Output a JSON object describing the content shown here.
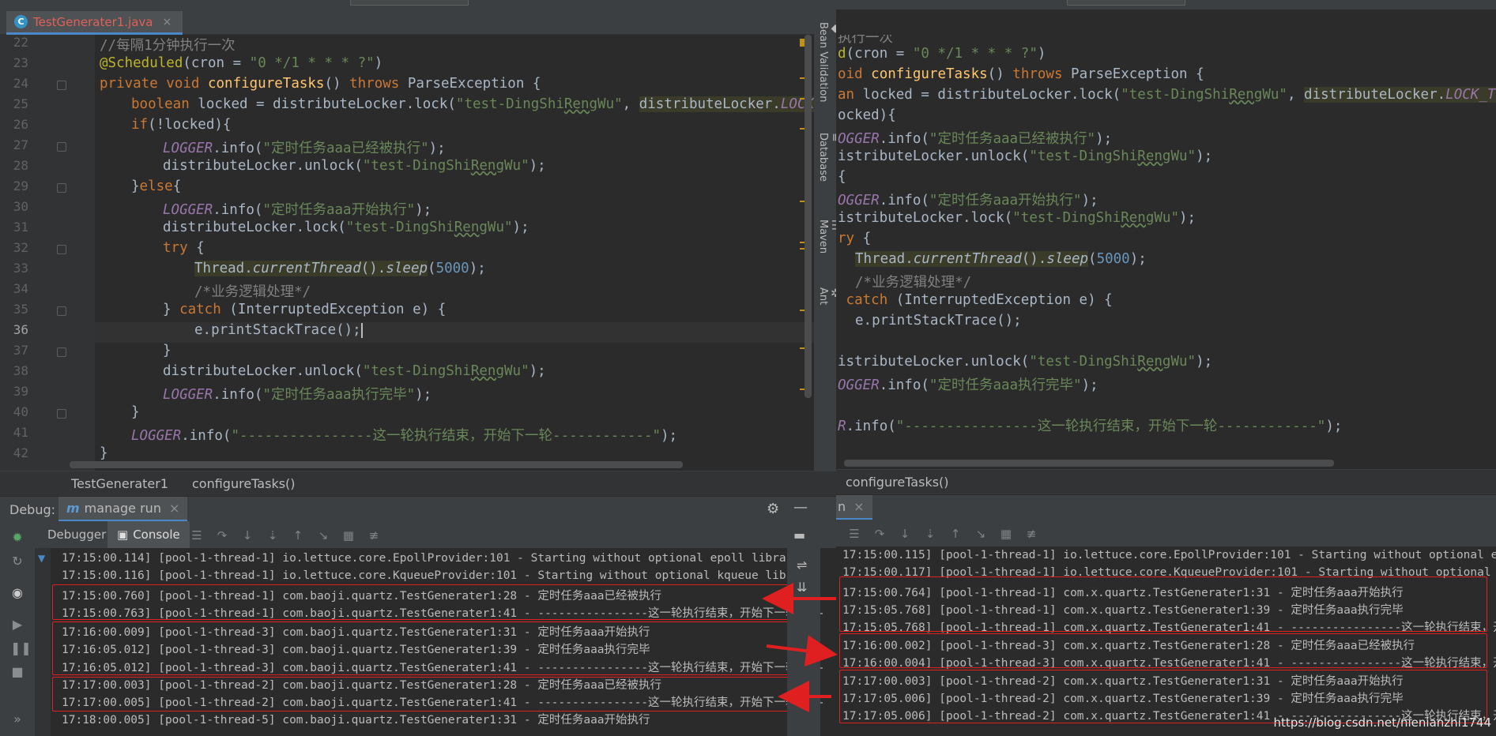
{
  "left_pane": {
    "tab": {
      "icon": "class-c-icon",
      "name": "TestGenerater1.java",
      "close": "×"
    },
    "code_lines": [
      {
        "n": "22"
      },
      {
        "n": "23"
      },
      {
        "n": "24"
      },
      {
        "n": "25"
      },
      {
        "n": "26"
      },
      {
        "n": "27"
      },
      {
        "n": "28"
      },
      {
        "n": "29"
      },
      {
        "n": "30"
      },
      {
        "n": "31"
      },
      {
        "n": "32"
      },
      {
        "n": "33"
      },
      {
        "n": "34"
      },
      {
        "n": "35"
      },
      {
        "n": "36"
      },
      {
        "n": "37"
      },
      {
        "n": "38"
      },
      {
        "n": "39"
      },
      {
        "n": "40"
      },
      {
        "n": "41"
      },
      {
        "n": "42"
      }
    ],
    "current_line": "36",
    "breadcrumb": [
      "TestGenerater1",
      "configureTasks()"
    ],
    "side_tabs": [
      "Bean Validation",
      "Database",
      "Maven",
      "Ant"
    ],
    "debug": {
      "label": "Debug:",
      "config": "manage run",
      "tabs": [
        "Debugger",
        "Console"
      ]
    },
    "console_lines": [
      "17:15:00.114] [pool-1-thread-1] io.lettuce.core.EpollProvider:101 - Starting without optional epoll library",
      "17:15:00.116] [pool-1-thread-1] io.lettuce.core.KqueueProvider:101 - Starting without optional kqueue library",
      "17:15:00.760] [pool-1-thread-1] com.baoji.quartz.TestGenerater1:28 - 定时任务aaa已经被执行",
      "17:15:00.763] [pool-1-thread-1] com.baoji.quartz.TestGenerater1:41 - ----------------这一轮执行结束，开始下一轮----",
      "17:16:00.009] [pool-1-thread-3] com.baoji.quartz.TestGenerater1:31 - 定时任务aaa开始执行",
      "17:16:05.012] [pool-1-thread-3] com.baoji.quartz.TestGenerater1:39 - 定时任务aaa执行完毕",
      "17:16:05.012] [pool-1-thread-3] com.baoji.quartz.TestGenerater1:41 - ----------------这一轮执行结束，开始下一轮----",
      "17:17:00.003] [pool-1-thread-2] com.baoji.quartz.TestGenerater1:28 - 定时任务aaa已经被执行",
      "17:17:00.005] [pool-1-thread-2] com.baoji.quartz.TestGenerater1:41 - ----------------这一轮执行结束，开始下一轮----",
      "17:18:00.005] [pool-1-thread-5] com.baoji.quartz.TestGenerater1:31 - 定时任务aaa开始执行"
    ]
  },
  "right_pane": {
    "breadcrumb": [
      "configureTasks()"
    ],
    "debug_tab": "n",
    "console_lines": [
      "17:15:00.115] [pool-1-thread-1] io.lettuce.core.EpollProvider:101 - Starting without optional epoll libr",
      "17:15:00.117] [pool-1-thread-1] io.lettuce.core.KqueueProvider:101 - Starting without optional kqueue li",
      "17:15:00.764] [pool-1-thread-1] com.x.quartz.TestGenerater1:31 - 定时任务aaa开始执行",
      "17:15:05.768] [pool-1-thread-1] com.x.quartz.TestGenerater1:39 - 定时任务aaa执行完毕",
      "17:15:05.768] [pool-1-thread-1] com.x.quartz.TestGenerater1:41 - ----------------这一轮执行结束，开始下一",
      "17:16:00.002] [pool-1-thread-3] com.x.quartz.TestGenerater1:28 - 定时任务aaa已经被执行",
      "17:16:00.004] [pool-1-thread-3] com.x.quartz.TestGenerater1:41 - ----------------这一轮执行结束，开始下一",
      "17:17:00.003] [pool-1-thread-2] com.x.quartz.TestGenerater1:31 - 定时任务aaa开始执行",
      "17:17:05.006] [pool-1-thread-2] com.x.quartz.TestGenerater1:39 - 定时任务aaa执行完毕",
      "17:17:05.006] [pool-1-thread-2] com.x.quartz.TestGenerater1:41 - ----------------这一轮执行结束，开始下"
    ]
  },
  "watermark": "https://blog.csdn.net/nienianzhi1744",
  "colors": {
    "keyword": "#cc7832",
    "string": "#6a8759",
    "annotation": "#bbb529",
    "number": "#6897bb",
    "static_field": "#9876aa",
    "box": "#e02020"
  }
}
